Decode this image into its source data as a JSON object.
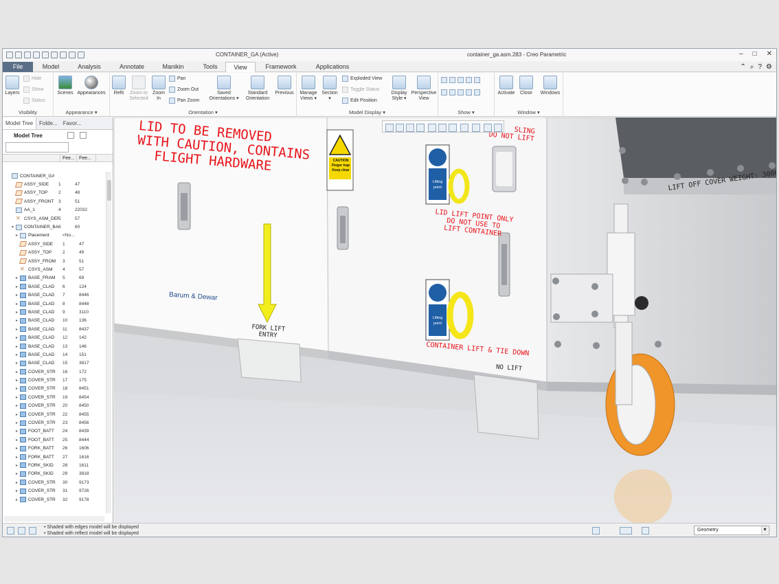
{
  "title": {
    "active_window": "CONTAINER_GA (Active)",
    "file_and_app": "container_ga.asm.283 - Creo Parametric"
  },
  "tabs": [
    {
      "label": "File"
    },
    {
      "label": "Model"
    },
    {
      "label": "Analysis"
    },
    {
      "label": "Annotate"
    },
    {
      "label": "Manikin"
    },
    {
      "label": "Tools"
    },
    {
      "label": "View"
    },
    {
      "label": "Framework"
    },
    {
      "label": "Applications"
    }
  ],
  "ribbon": {
    "visibility": {
      "layers": "Layers",
      "hide": "Hide",
      "show": "Show",
      "status": "Status",
      "label": "Visibility"
    },
    "appearance": {
      "scenes": "Scenes",
      "appearances": "Appearances",
      "label": "Appearance ▾"
    },
    "orientation": {
      "refit": "Refit",
      "zoom_selected": "Zoom to Selected",
      "zoom_in": "Zoom In",
      "pan": "Pan",
      "zoom_out": "Zoom Out",
      "pan_zoom": "Pan Zoom",
      "saved": "Saved Orientations ▾",
      "standard": "Standard Orientation",
      "previous": "Previous",
      "label": "Orientation ▾"
    },
    "model_display": {
      "manage_views": "Manage Views ▾",
      "section": "Section ▾",
      "exploded": "Exploded View",
      "toggle_status": "Toggle Status",
      "edit_position": "Edit Position",
      "display_style": "Display Style ▾",
      "perspective": "Perspective View",
      "label": "Model Display ▾"
    },
    "show": {
      "label": "Show ▾"
    },
    "window": {
      "activate": "Activate",
      "close": "Close",
      "windows": "Windows",
      "label": "Window ▾"
    }
  },
  "panel": {
    "tabs": [
      "Model Tree",
      "Folde...",
      "Favor..."
    ],
    "tree_label": "Model Tree",
    "columns": [
      "",
      "Fee...",
      "Fee..."
    ],
    "rows": [
      {
        "name": "CONTAINER_GA.AS",
        "feat": "",
        "val": "",
        "icon": "asm",
        "exp": "",
        "indent": 0
      },
      {
        "name": "ASSY_SIDE",
        "feat": "1",
        "val": "47",
        "icon": "plane",
        "exp": "",
        "indent": 1
      },
      {
        "name": "ASSY_TOP",
        "feat": "2",
        "val": "48",
        "icon": "plane",
        "exp": "",
        "indent": 1
      },
      {
        "name": "ASSY_FRONT",
        "feat": "3",
        "val": "51",
        "icon": "plane",
        "exp": "",
        "indent": 1
      },
      {
        "name": "AA_1",
        "feat": "4",
        "val": "22032",
        "icon": "axis",
        "exp": "",
        "indent": 1
      },
      {
        "name": "CSYS_ASM_DEF",
        "feat": "5",
        "val": "57",
        "icon": "csys",
        "exp": "",
        "indent": 1
      },
      {
        "name": "CONTAINER_BA",
        "feat": "6",
        "val": "60",
        "icon": "asm",
        "exp": "▾",
        "indent": 1
      },
      {
        "name": "Placement",
        "feat": "<No...",
        "val": "",
        "icon": "asm",
        "exp": "▸",
        "indent": 2
      },
      {
        "name": "ASSY_SIDE",
        "feat": "1",
        "val": "47",
        "icon": "plane",
        "exp": "",
        "indent": 2
      },
      {
        "name": "ASSY_TOP",
        "feat": "2",
        "val": "49",
        "icon": "plane",
        "exp": "",
        "indent": 2
      },
      {
        "name": "ASSY_FROM",
        "feat": "3",
        "val": "51",
        "icon": "plane",
        "exp": "",
        "indent": 2
      },
      {
        "name": "CSYS_ASM",
        "feat": "4",
        "val": "57",
        "icon": "csys",
        "exp": "",
        "indent": 2
      },
      {
        "name": "BASE_FRAM",
        "feat": "5",
        "val": "69",
        "icon": "part",
        "exp": "▸",
        "indent": 2
      },
      {
        "name": "BASE_CLAD",
        "feat": "6",
        "val": "124",
        "icon": "part",
        "exp": "▸",
        "indent": 2
      },
      {
        "name": "BASE_CLAD",
        "feat": "7",
        "val": "8446",
        "icon": "part",
        "exp": "▸",
        "indent": 2
      },
      {
        "name": "BASE_CLAD",
        "feat": "8",
        "val": "8448",
        "icon": "part",
        "exp": "▸",
        "indent": 2
      },
      {
        "name": "BASE_CLAD",
        "feat": "9",
        "val": "3110",
        "icon": "part",
        "exp": "▸",
        "indent": 2
      },
      {
        "name": "BASE_CLAD",
        "feat": "10",
        "val": "136",
        "icon": "part",
        "exp": "▸",
        "indent": 2
      },
      {
        "name": "BASE_CLAD",
        "feat": "11",
        "val": "8437",
        "icon": "part",
        "exp": "▸",
        "indent": 2
      },
      {
        "name": "BASE_CLAD",
        "feat": "12",
        "val": "142",
        "icon": "part",
        "exp": "▸",
        "indent": 2
      },
      {
        "name": "BASE_CLAD",
        "feat": "13",
        "val": "146",
        "icon": "part",
        "exp": "▸",
        "indent": 2
      },
      {
        "name": "BASE_CLAD",
        "feat": "14",
        "val": "151",
        "icon": "part",
        "exp": "▸",
        "indent": 2
      },
      {
        "name": "BASE_CLAD",
        "feat": "15",
        "val": "3817",
        "icon": "part",
        "exp": "▸",
        "indent": 2
      },
      {
        "name": "COVER_STR",
        "feat": "16",
        "val": "172",
        "icon": "part",
        "exp": "▸",
        "indent": 2
      },
      {
        "name": "COVER_STR",
        "feat": "17",
        "val": "175",
        "icon": "part",
        "exp": "▸",
        "indent": 2
      },
      {
        "name": "COVER_STR",
        "feat": "18",
        "val": "8451",
        "icon": "part",
        "exp": "▸",
        "indent": 2
      },
      {
        "name": "COVER_STR",
        "feat": "19",
        "val": "8454",
        "icon": "part",
        "exp": "▸",
        "indent": 2
      },
      {
        "name": "COVER_STR",
        "feat": "20",
        "val": "8450",
        "icon": "part",
        "exp": "▸",
        "indent": 2
      },
      {
        "name": "COVER_STR",
        "feat": "22",
        "val": "8455",
        "icon": "part",
        "exp": "▸",
        "indent": 2
      },
      {
        "name": "COVER_STR",
        "feat": "23",
        "val": "8456",
        "icon": "part",
        "exp": "▸",
        "indent": 2
      },
      {
        "name": "FOOT_BATT",
        "feat": "24",
        "val": "8439",
        "icon": "part",
        "exp": "▸",
        "indent": 2
      },
      {
        "name": "FOOT_BATT",
        "feat": "25",
        "val": "8444",
        "icon": "part",
        "exp": "▸",
        "indent": 2
      },
      {
        "name": "FORK_BATT",
        "feat": "26",
        "val": "1606",
        "icon": "part",
        "exp": "▸",
        "indent": 2
      },
      {
        "name": "FORK_BATT",
        "feat": "27",
        "val": "1616",
        "icon": "part",
        "exp": "▸",
        "indent": 2
      },
      {
        "name": "FORK_SKID",
        "feat": "28",
        "val": "1611",
        "icon": "part",
        "exp": "▸",
        "indent": 2
      },
      {
        "name": "FORK_SKID",
        "feat": "29",
        "val": "3818",
        "icon": "part",
        "exp": "▸",
        "indent": 2
      },
      {
        "name": "COVER_STR",
        "feat": "30",
        "val": "9173",
        "icon": "part",
        "exp": "▸",
        "indent": 2
      },
      {
        "name": "COVER_STR",
        "feat": "31",
        "val": "9726",
        "icon": "part",
        "exp": "▸",
        "indent": 2
      },
      {
        "name": "COVER_STR",
        "feat": "32",
        "val": "9178",
        "icon": "part",
        "exp": "▸",
        "indent": 2
      }
    ]
  },
  "viewport": {
    "lid_warning": [
      "LID TO BE REMOVED",
      "WITH CAUTION, CONTAINS",
      "FLIGHT HARDWARE"
    ],
    "fork_lift": [
      "FORK LIFT",
      "ENTRY"
    ],
    "brand": "Barum & Dewar",
    "caution": [
      "CAUTION",
      "Finger trap",
      "Keep clear"
    ],
    "lifting": [
      "Lifting",
      "point"
    ],
    "lid_lift": [
      "LID LIFT POINT ONLY",
      "DO NOT USE TO",
      "LIFT CONTAINER"
    ],
    "sling": [
      "SLING",
      "DO NOT LIFT"
    ],
    "container_lift": "CONTAINER LIFT & TIE DOWN",
    "no_lift": "NO LIFT",
    "cover_weight": "LIFT OFF COVER WEIGHT: 300K",
    "colors": {
      "warning_red": "#e8141a",
      "arrow_yellow": "#f5f51e",
      "wheel_orange": "#f0952a",
      "hook_yellow": "#f5e61a",
      "sign_blue": "#1f5fa6"
    }
  },
  "status": {
    "messages": [
      "Shaded with edges model will be displayed",
      "Shaded with reflect model will be displayed"
    ],
    "filter": "Geometry"
  }
}
